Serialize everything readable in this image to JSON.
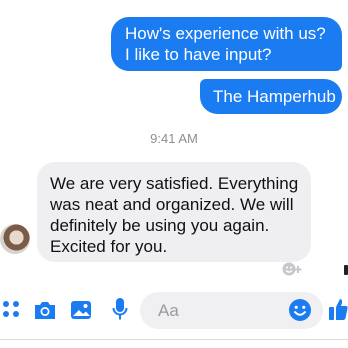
{
  "messages": [
    {
      "text": "How's experience with us? I like to have input?"
    },
    {
      "text": "The Hamperhub"
    },
    {
      "text": "We are very satisfied. Everything was neat and organized. We will definitely be using you again. Excited for you."
    }
  ],
  "timestamp": "9:41 AM",
  "composer": {
    "placeholder": "Aa"
  },
  "colors": {
    "accent": "#1b7cf1",
    "bubble_in": "#efeff2"
  },
  "icons": [
    "apps-icon",
    "camera-icon",
    "image-icon",
    "microphone-icon",
    "emoji-icon",
    "thumbs-up-icon",
    "add-reaction-icon"
  ]
}
